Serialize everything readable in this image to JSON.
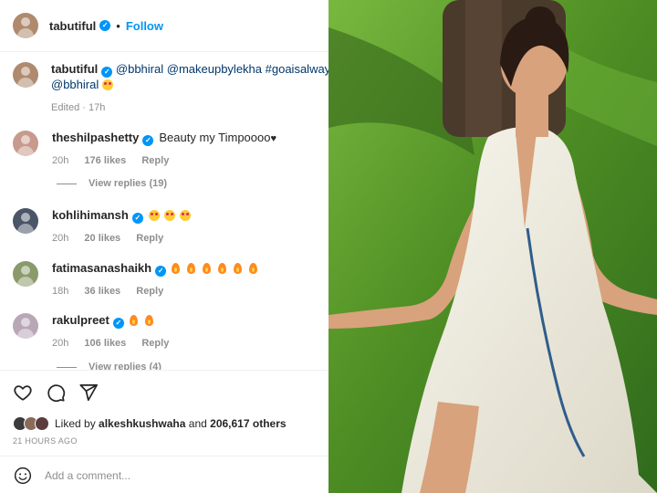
{
  "header": {
    "username": "tabutiful",
    "separator": "•",
    "follow_label": "Follow"
  },
  "caption": {
    "username": "tabutiful",
    "line1": [
      {
        "text": "@bbhiral",
        "type": "mention"
      },
      {
        "text": "@makeupbylekha",
        "type": "mention"
      },
      {
        "text": "#goaisalwaysgo",
        "type": "mention"
      }
    ],
    "line2_mention": "@bbhiral",
    "edited": "Edited",
    "separator": "·",
    "time": "17h"
  },
  "comments": [
    {
      "username": "theshilpashetty",
      "text": "Beauty my Timpoooo",
      "trailing": "♥",
      "emoji": [],
      "time": "20h",
      "likes": "176 likes",
      "reply": "Reply",
      "avatar_color": "#c79a8d",
      "view_replies": "View replies (19)"
    },
    {
      "username": "kohlihimansh",
      "text": "",
      "trailing": "",
      "emoji": [
        "heart-eyes",
        "heart-eyes",
        "heart-eyes"
      ],
      "time": "20h",
      "likes": "20 likes",
      "reply": "Reply",
      "avatar_color": "#4a5568",
      "view_replies": ""
    },
    {
      "username": "fatimasanashaikh",
      "text": "",
      "trailing": "",
      "emoji": [
        "fire",
        "fire",
        "fire",
        "fire",
        "fire",
        "fire"
      ],
      "time": "18h",
      "likes": "36 likes",
      "reply": "Reply",
      "avatar_color": "#8a9a6b",
      "view_replies": ""
    },
    {
      "username": "rakulpreet",
      "text": "",
      "trailing": "",
      "emoji": [
        "fire",
        "fire"
      ],
      "time": "20h",
      "likes": "106 likes",
      "reply": "Reply",
      "avatar_color": "#b9a7b8",
      "view_replies": "View replies (4)"
    }
  ],
  "actions": {
    "icons": [
      "heart-icon",
      "comment-icon",
      "share-icon"
    ],
    "liked_by_prefix": "Liked by",
    "liked_by_user": "alkeshkushwaha",
    "liked_by_connector": "and",
    "liked_by_count": "206,617 others",
    "timestamp": "21 HOURS AGO"
  },
  "comment_box": {
    "placeholder": "Add a comment..."
  },
  "colors": {
    "verified": "#0095f6",
    "follow": "#0095f6",
    "mention": "#00376b",
    "muted": "#8e8e8e",
    "grass": "#4d8a2b"
  }
}
